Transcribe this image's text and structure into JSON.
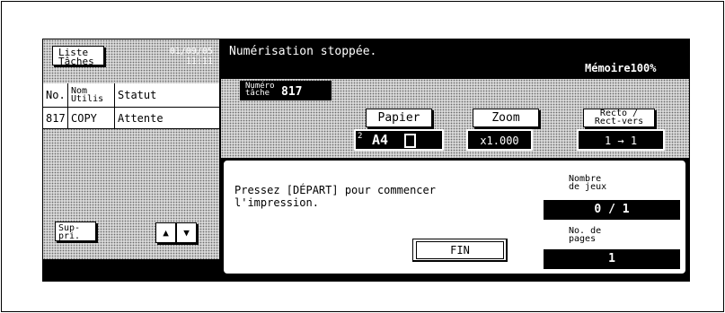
{
  "left_panel": {
    "job_list_button": "Liste\nTâches",
    "date": "01/09/05",
    "time": "11:11",
    "columns": [
      "No.",
      "Nom\nUtilis",
      "Statut"
    ],
    "rows": [
      [
        "817",
        "COPY",
        "Attente"
      ]
    ],
    "delete_button": "Sup-\npri.",
    "up_arrow": "▲",
    "down_arrow": "▼"
  },
  "header": {
    "status_message": "Numérisation stoppée.",
    "memory": "Mémoire100%"
  },
  "job": {
    "number_label": "Numéro\ntâche",
    "number": "817"
  },
  "settings": {
    "paper_label": "Papier",
    "paper_value": "A4",
    "paper_tray": "2",
    "zoom_label": "Zoom",
    "zoom_value": "x1.000",
    "duplex_label": "Recto /\nRect-vers",
    "duplex_value": "1 → 1"
  },
  "dialog": {
    "message": "Pressez [DÉPART] pour commencer\nl'impression.",
    "end_button": "FIN",
    "sets_label": "Nombre\nde jeux",
    "sets_value": "0 / 1",
    "pages_label": "No. de\npages",
    "pages_value": "1"
  },
  "colors": {
    "screen": "#000000",
    "dotted": "#d8d8d8",
    "text_on_black": "#ffffff"
  }
}
